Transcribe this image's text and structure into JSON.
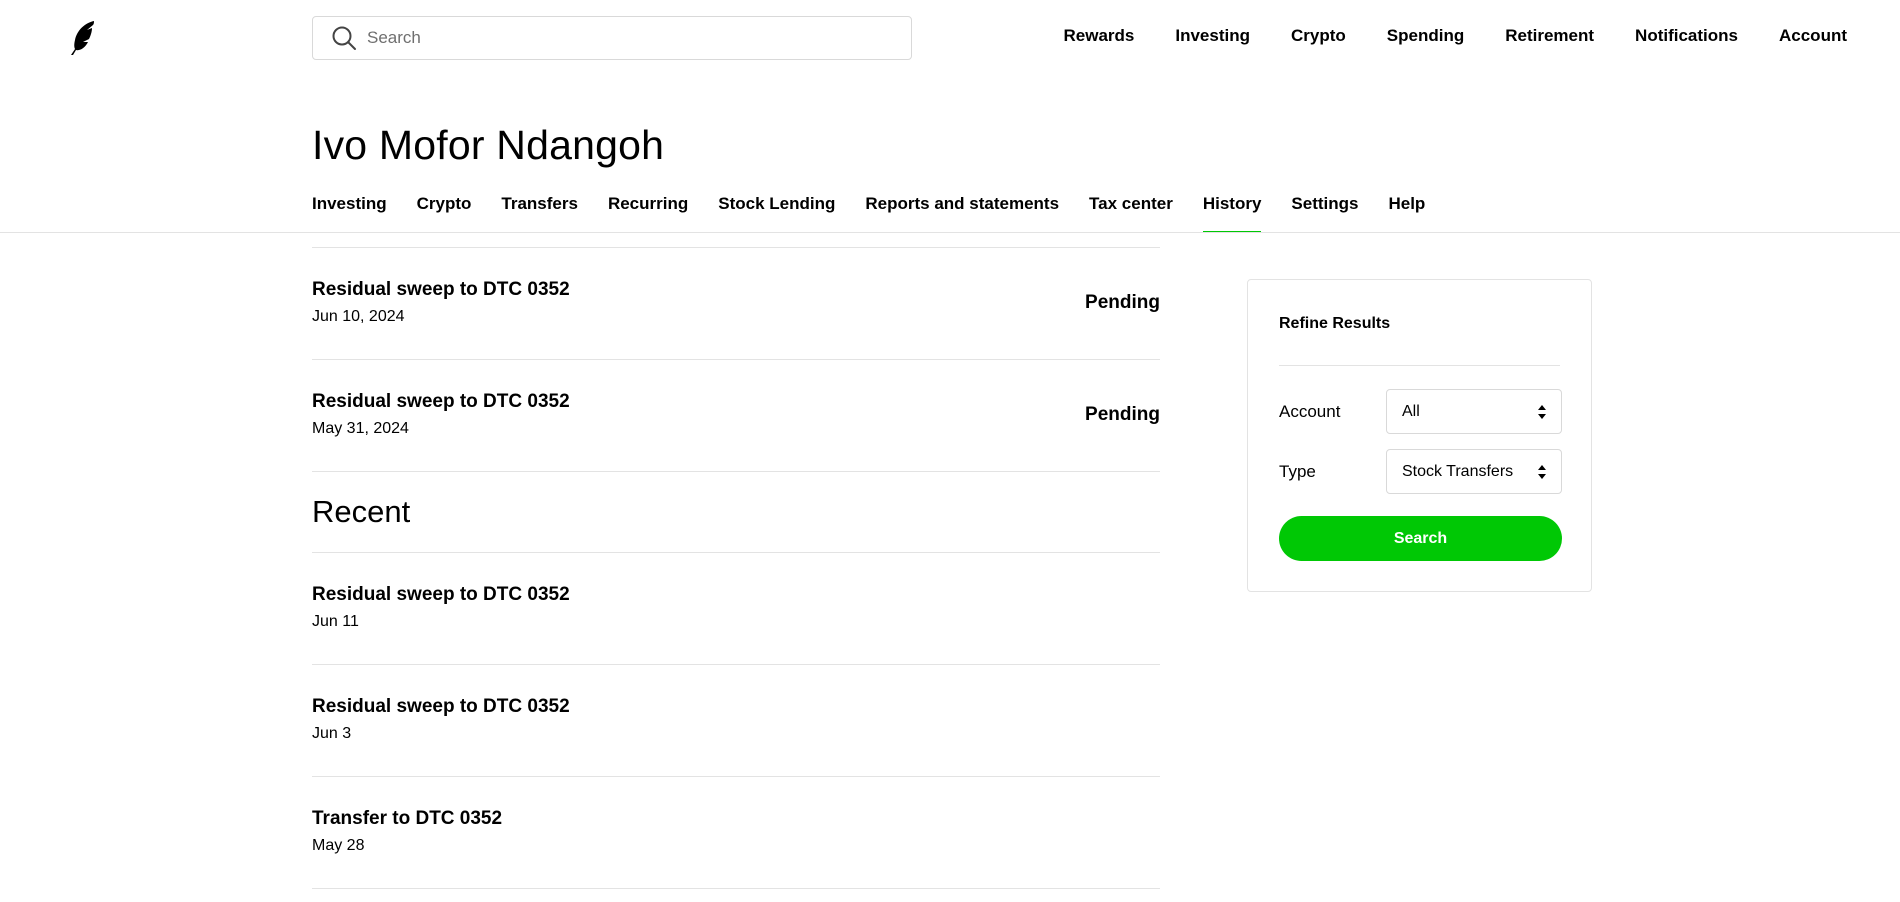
{
  "top_bar": {
    "search_placeholder": "Search",
    "nav": [
      "Rewards",
      "Investing",
      "Crypto",
      "Spending",
      "Retirement",
      "Notifications",
      "Account"
    ]
  },
  "header": {
    "title": "Ivo Mofor Ndangoh",
    "tabs": [
      "Investing",
      "Crypto",
      "Transfers",
      "Recurring",
      "Stock Lending",
      "Reports and statements",
      "Tax center",
      "History",
      "Settings",
      "Help"
    ],
    "active_tab": "History"
  },
  "pending_items": [
    {
      "title": "Residual sweep to DTC 0352",
      "date": "Jun 10, 2024",
      "status": "Pending"
    },
    {
      "title": "Residual sweep to DTC 0352",
      "date": "May 31, 2024",
      "status": "Pending"
    }
  ],
  "recent": {
    "heading": "Recent",
    "items": [
      {
        "title": "Residual sweep to DTC 0352",
        "date": "Jun 11"
      },
      {
        "title": "Residual sweep to DTC 0352",
        "date": "Jun 3"
      },
      {
        "title": "Transfer to DTC 0352",
        "date": "May 28"
      }
    ]
  },
  "refine": {
    "title": "Refine Results",
    "account_label": "Account",
    "account_value": "All",
    "type_label": "Type",
    "type_value": "Stock Transfers",
    "search_button": "Search"
  },
  "colors": {
    "accent": "#00c805",
    "highlight_row": "#f2f2f2",
    "divider": "#e3e3e3"
  },
  "icons": {
    "logo": "feather-icon",
    "search": "search-icon",
    "select": "sort-arrows-icon"
  }
}
